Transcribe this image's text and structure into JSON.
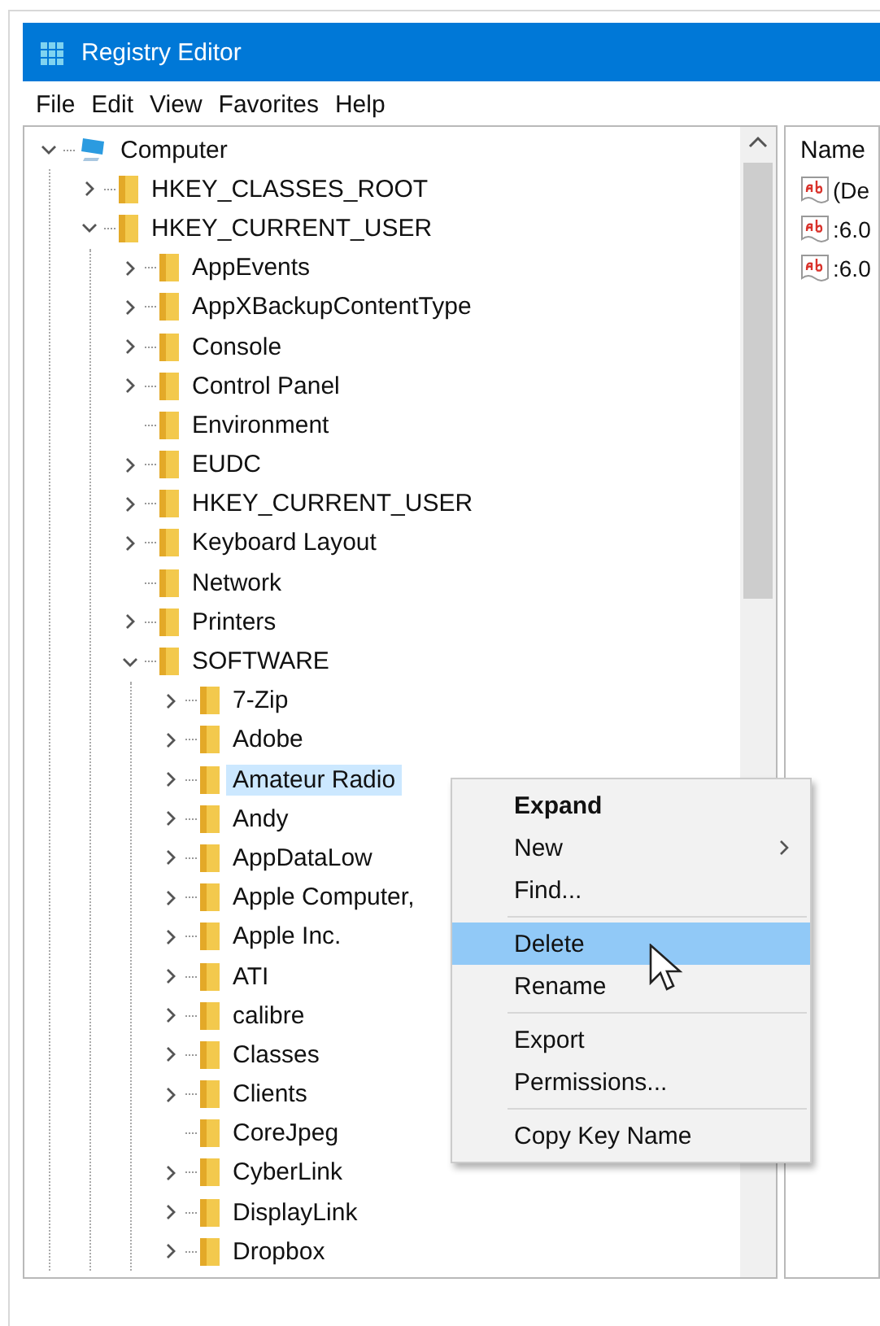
{
  "window": {
    "title": "Registry Editor"
  },
  "menu_bar": [
    "File",
    "Edit",
    "View",
    "Favorites",
    "Help"
  ],
  "tree": [
    {
      "name": "Computer",
      "kind": "computer",
      "expanded": true,
      "selected": false,
      "children": [
        {
          "name": "HKEY_CLASSES_ROOT",
          "kind": "folder",
          "expanded": false,
          "selected": false
        },
        {
          "name": "HKEY_CURRENT_USER",
          "kind": "folder",
          "expanded": true,
          "selected": false,
          "children": [
            {
              "name": "AppEvents",
              "kind": "folder",
              "expanded": false,
              "selected": false
            },
            {
              "name": "AppXBackupContentType",
              "kind": "folder",
              "expanded": false,
              "selected": false
            },
            {
              "name": "Console",
              "kind": "folder",
              "expanded": false,
              "selected": false
            },
            {
              "name": "Control Panel",
              "kind": "folder",
              "expanded": false,
              "selected": false
            },
            {
              "name": "Environment",
              "kind": "folder",
              "selected": false
            },
            {
              "name": "EUDC",
              "kind": "folder",
              "expanded": false,
              "selected": false
            },
            {
              "name": "HKEY_CURRENT_USER",
              "kind": "folder",
              "expanded": false,
              "selected": false
            },
            {
              "name": "Keyboard Layout",
              "kind": "folder",
              "expanded": false,
              "selected": false
            },
            {
              "name": "Network",
              "kind": "folder",
              "selected": false
            },
            {
              "name": "Printers",
              "kind": "folder",
              "expanded": false,
              "selected": false
            },
            {
              "name": "SOFTWARE",
              "kind": "folder",
              "expanded": true,
              "selected": false,
              "children": [
                {
                  "name": "7-Zip",
                  "kind": "folder",
                  "expanded": false,
                  "selected": false
                },
                {
                  "name": "Adobe",
                  "kind": "folder",
                  "expanded": false,
                  "selected": false
                },
                {
                  "name": "Amateur Radio",
                  "kind": "folder",
                  "expanded": false,
                  "selected": true
                },
                {
                  "name": "Andy",
                  "kind": "folder",
                  "expanded": false,
                  "selected": false
                },
                {
                  "name": "AppDataLow",
                  "kind": "folder",
                  "expanded": false,
                  "selected": false
                },
                {
                  "name": "Apple Computer,",
                  "kind": "folder",
                  "expanded": false,
                  "selected": false
                },
                {
                  "name": "Apple Inc.",
                  "kind": "folder",
                  "expanded": false,
                  "selected": false
                },
                {
                  "name": "ATI",
                  "kind": "folder",
                  "expanded": false,
                  "selected": false
                },
                {
                  "name": "calibre",
                  "kind": "folder",
                  "expanded": false,
                  "selected": false
                },
                {
                  "name": "Classes",
                  "kind": "folder",
                  "expanded": false,
                  "selected": false
                },
                {
                  "name": "Clients",
                  "kind": "folder",
                  "expanded": false,
                  "selected": false
                },
                {
                  "name": "CoreJpeg",
                  "kind": "folder",
                  "selected": false
                },
                {
                  "name": "CyberLink",
                  "kind": "folder",
                  "expanded": false,
                  "selected": false
                },
                {
                  "name": "DisplayLink",
                  "kind": "folder",
                  "expanded": false,
                  "selected": false
                },
                {
                  "name": "Dropbox",
                  "kind": "folder",
                  "expanded": false,
                  "selected": false
                }
              ]
            }
          ]
        }
      ]
    }
  ],
  "list_pane": {
    "columns": [
      "Name"
    ],
    "rows": [
      {
        "name": "(De"
      },
      {
        "name": ":6.0"
      },
      {
        "name": ":6.0"
      }
    ]
  },
  "context_menu": [
    {
      "kind": "item",
      "label": "Expand",
      "default": true,
      "submenu": false,
      "selected": false
    },
    {
      "kind": "item",
      "label": "New",
      "default": false,
      "submenu": true,
      "selected": false
    },
    {
      "kind": "item",
      "label": "Find...",
      "default": false,
      "submenu": false,
      "selected": false
    },
    {
      "kind": "separator"
    },
    {
      "kind": "item",
      "label": "Delete",
      "default": false,
      "submenu": false,
      "selected": true
    },
    {
      "kind": "item",
      "label": "Rename",
      "default": false,
      "submenu": false,
      "selected": false
    },
    {
      "kind": "separator"
    },
    {
      "kind": "item",
      "label": "Export",
      "default": false,
      "submenu": false,
      "selected": false
    },
    {
      "kind": "item",
      "label": "Permissions...",
      "default": false,
      "submenu": false,
      "selected": false
    },
    {
      "kind": "separator"
    },
    {
      "kind": "item",
      "label": "Copy Key Name",
      "default": false,
      "submenu": false,
      "selected": false
    }
  ]
}
